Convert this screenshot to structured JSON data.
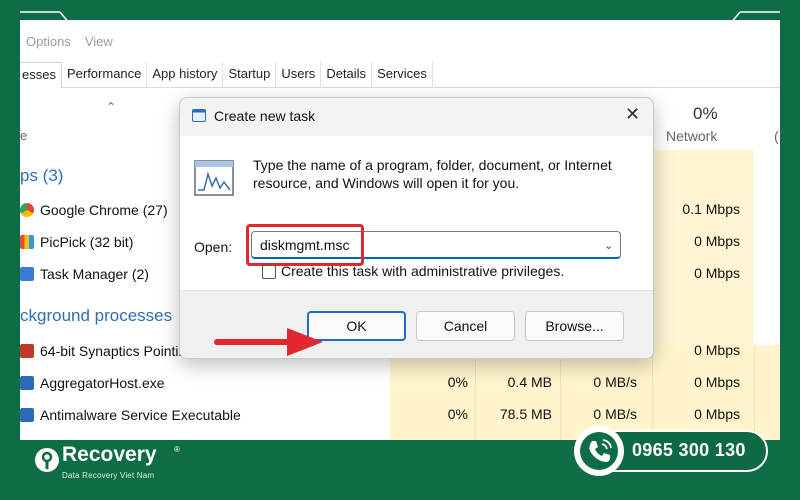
{
  "menubar": {
    "options": "Options",
    "view": "View"
  },
  "tabs": [
    {
      "label": "esses"
    },
    {
      "label": "Performance"
    },
    {
      "label": "App history"
    },
    {
      "label": "Startup"
    },
    {
      "label": "Users"
    },
    {
      "label": "Details"
    },
    {
      "label": "Services"
    }
  ],
  "columns": {
    "name_partial": "e",
    "network_pct": "0%",
    "network": "Network",
    "next_partial": "("
  },
  "groups": {
    "apps": "ps (3)",
    "background": "ckground processes"
  },
  "apps": [
    {
      "name": "Google Chrome (27)",
      "network": "0.1 Mbps"
    },
    {
      "name": "PicPick (32 bit)",
      "network": "0 Mbps"
    },
    {
      "name": "Task Manager (2)",
      "network": "0 Mbps"
    }
  ],
  "background": [
    {
      "name": "64-bit Synaptics Pointin",
      "cpu": "",
      "memory": "",
      "disk": "",
      "network": "0 Mbps"
    },
    {
      "name": "AggregatorHost.exe",
      "cpu": "0%",
      "memory": "0.4 MB",
      "disk": "0 MB/s",
      "network": "0 Mbps"
    },
    {
      "name": "Antimalware Service Executable",
      "cpu": "0%",
      "memory": "78.5 MB",
      "disk": "0 MB/s",
      "network": "0 Mbps"
    }
  ],
  "dialog": {
    "title": "Create new task",
    "description": "Type the name of a program, folder, document, or Internet resource, and Windows will open it for you.",
    "open_label": "Open:",
    "open_value": "diskmgmt.msc",
    "admin_label": "Create this task with administrative privileges.",
    "ok": "OK",
    "cancel": "Cancel",
    "browse": "Browse..."
  },
  "brand": {
    "name": "Recovery",
    "tagline": "Data Recovery Viet Nam",
    "reg": "®",
    "phone": "0965 300 130"
  },
  "colors": {
    "background_green": "#0f6d45",
    "highlight_red": "#e0282e",
    "accent_blue": "#1a6cc4",
    "group_blue": "#2f6fb0"
  }
}
